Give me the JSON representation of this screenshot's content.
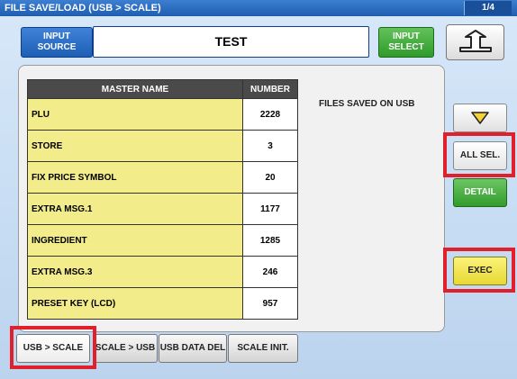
{
  "window": {
    "title": "FILE SAVE/LOAD (USB > SCALE)",
    "page": "1/4"
  },
  "source": {
    "label_line1": "INPUT",
    "label_line2": "SOURCE",
    "value": "TEST"
  },
  "input_select": {
    "line1": "INPUT",
    "line2": "SELECT"
  },
  "table": {
    "headers": {
      "name": "MASTER NAME",
      "number": "NUMBER"
    },
    "rows": [
      {
        "name": "PLU",
        "number": "2228"
      },
      {
        "name": "STORE",
        "number": "3"
      },
      {
        "name": "FIX PRICE SYMBOL",
        "number": "20"
      },
      {
        "name": "EXTRA MSG.1",
        "number": "1177"
      },
      {
        "name": "INGREDIENT",
        "number": "1285"
      },
      {
        "name": "EXTRA MSG.3",
        "number": "246"
      },
      {
        "name": "PRESET KEY (LCD)",
        "number": "957"
      }
    ]
  },
  "note": "FILES SAVED ON USB",
  "side": {
    "all_sel": "ALL SEL.",
    "detail": "DETAIL",
    "exec": "EXEC"
  },
  "tabs": [
    {
      "label": "USB > SCALE"
    },
    {
      "label": "SCALE > USB"
    },
    {
      "label": "USB DATA DEL"
    },
    {
      "label": "SCALE INIT."
    }
  ],
  "colors": {
    "highlight": "#e0202a",
    "title_bar": "#2a6cc4",
    "name_cell": "#f2ec8a",
    "exec": "#efe04a",
    "detail": "#3aa834"
  }
}
